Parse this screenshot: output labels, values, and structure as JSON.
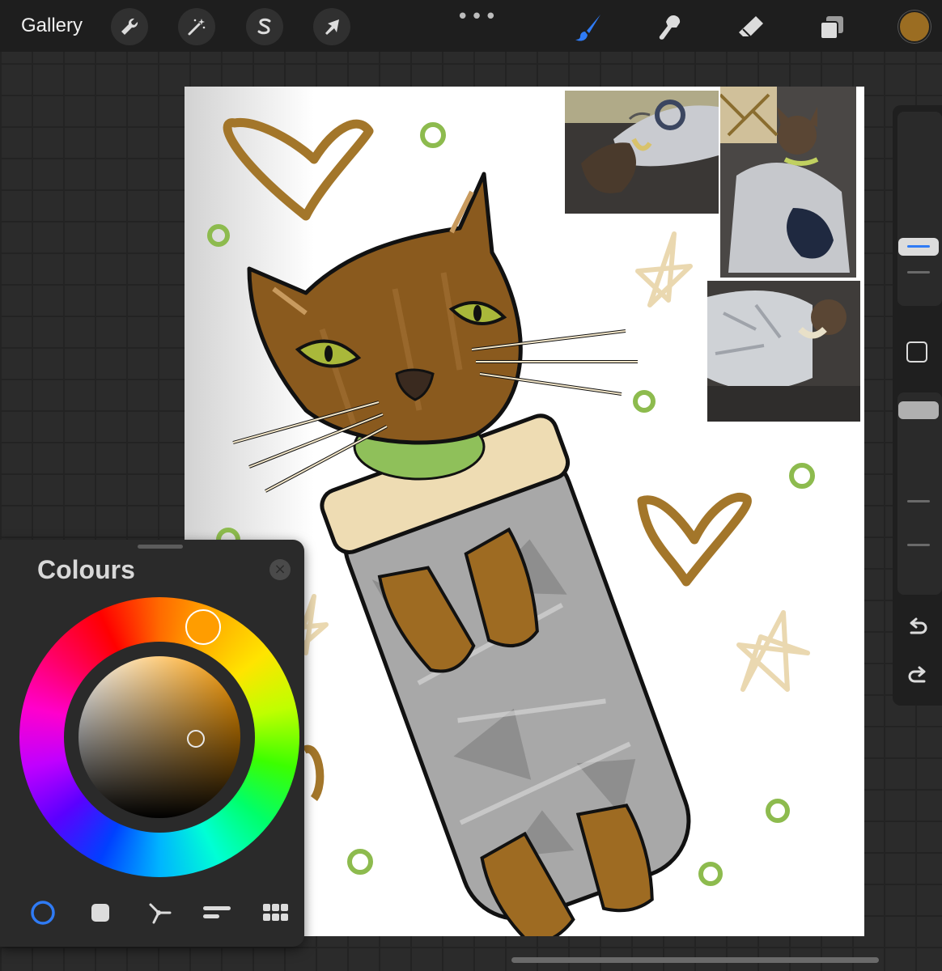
{
  "topbar": {
    "gallery_label": "Gallery",
    "left_tools": [
      "wrench-icon",
      "magic-wand-icon",
      "selection-s-icon",
      "arrow-transform-icon"
    ],
    "more_label": "•••",
    "right_tools": [
      "brush-icon",
      "smudge-icon",
      "eraser-icon",
      "layers-icon"
    ],
    "active_tool": "brush-icon",
    "active_tool_color": "#2f7bf5",
    "current_color": "#9b6d22"
  },
  "canvas": {
    "photos": [
      "cat-in-burrito-costume-photo-1",
      "cat-in-burrito-costume-photo-2",
      "cat-in-burrito-costume-photo-3"
    ]
  },
  "sidebar": {
    "brush_size_level": 0.23,
    "opacity_level": 0.0,
    "icons": [
      "modify-square-icon",
      "undo-icon",
      "redo-icon"
    ]
  },
  "colours_panel": {
    "title": "Colours",
    "close_label": "×",
    "modes": [
      "disc-mode-icon",
      "classic-mode-icon",
      "harmony-mode-icon",
      "value-mode-icon",
      "palettes-mode-icon"
    ],
    "active_mode": "disc-mode-icon",
    "hue_selector_color": "#ff9d00",
    "accent": "#2f7bf5"
  }
}
